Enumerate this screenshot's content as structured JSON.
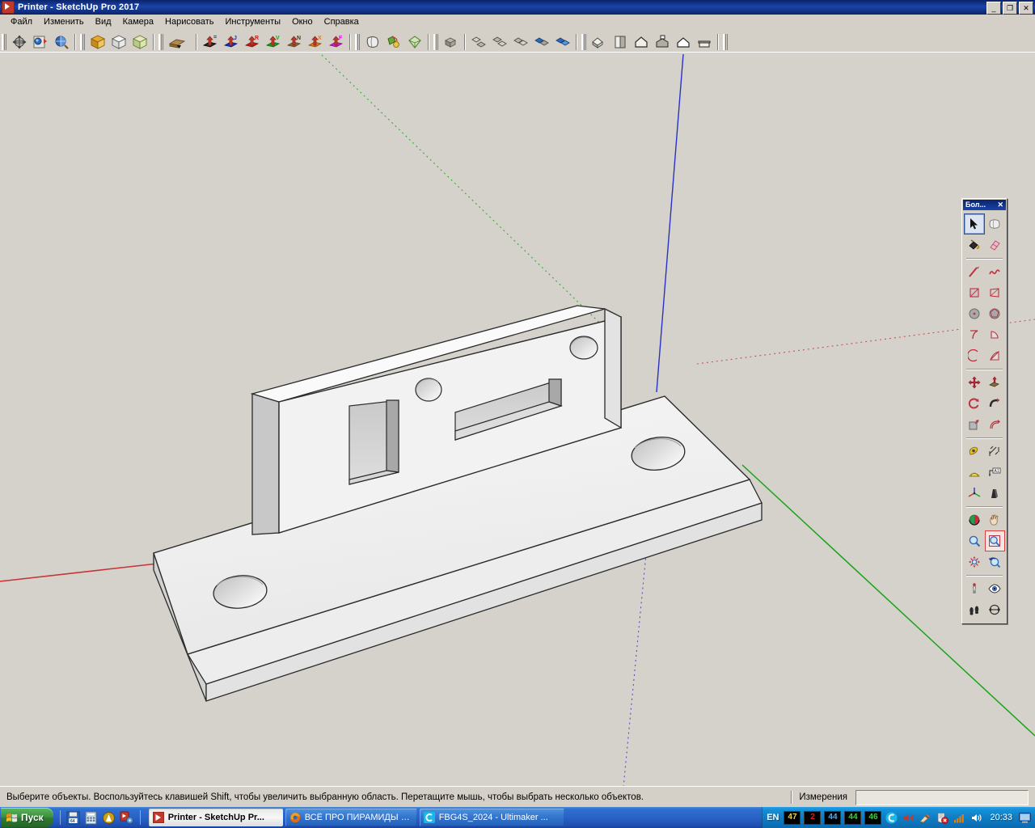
{
  "window": {
    "title": "Printer - SketchUp Pro 2017",
    "icon": "sketchup-icon",
    "controls": [
      {
        "name": "minimize-button",
        "glyph": "_"
      },
      {
        "name": "restore-button",
        "glyph": "❐"
      },
      {
        "name": "close-button",
        "glyph": "✕"
      }
    ]
  },
  "menubar": {
    "items": [
      {
        "label": "Файл",
        "name": "menu-file"
      },
      {
        "label": "Изменить",
        "name": "menu-edit"
      },
      {
        "label": "Вид",
        "name": "menu-view"
      },
      {
        "label": "Камера",
        "name": "menu-camera"
      },
      {
        "label": "Нарисовать",
        "name": "menu-draw"
      },
      {
        "label": "Инструменты",
        "name": "menu-tools"
      },
      {
        "label": "Окно",
        "name": "menu-window"
      },
      {
        "label": "Справка",
        "name": "menu-help"
      }
    ]
  },
  "toolbar": {
    "groups": [
      {
        "name": "standard-views-group",
        "buttons": [
          {
            "name": "orbit-icon",
            "title": "Орбита"
          },
          {
            "name": "position-camera-icon",
            "title": "Поместить камеру"
          },
          {
            "name": "walk-icon",
            "title": "Пройтись"
          }
        ]
      },
      {
        "name": "styles-group",
        "buttons": [
          {
            "name": "style-shaded-icon",
            "title": "С тенями"
          },
          {
            "name": "style-hidden-line-icon",
            "title": "Скрытая линия"
          },
          {
            "name": "style-texture-icon",
            "title": "С текстурой"
          }
        ]
      },
      {
        "name": "section-group",
        "buttons": [
          {
            "name": "section-plane-icon",
            "title": "Секущая плоскость"
          }
        ]
      },
      {
        "name": "axes-group",
        "buttons": [
          {
            "name": "layer-black-icon",
            "letter": "=",
            "color": "#1a1a1a"
          },
          {
            "name": "layer-blue-icon",
            "letter": "J",
            "color": "#1434b8"
          },
          {
            "name": "layer-red-icon",
            "letter": "R",
            "color": "#c0201c"
          },
          {
            "name": "layer-green-icon",
            "letter": "V",
            "color": "#1aa01a"
          },
          {
            "name": "layer-brown-icon",
            "letter": "N",
            "color": "#8a6a38"
          },
          {
            "name": "layer-orange-icon",
            "letter": "X",
            "color": "#e07818"
          },
          {
            "name": "layer-magenta-icon",
            "letter": "F",
            "color": "#d41ad4"
          }
        ]
      },
      {
        "name": "solid-tools-group",
        "buttons": [
          {
            "name": "solid-outer-shell-icon"
          },
          {
            "name": "solid-intersect-icon"
          },
          {
            "name": "solid-union-icon"
          }
        ]
      },
      {
        "name": "group-tools-group",
        "buttons": [
          {
            "name": "make-group-icon"
          }
        ]
      },
      {
        "name": "component-tools-group",
        "buttons": [
          {
            "name": "explode-icon"
          },
          {
            "name": "component-edit-icon"
          },
          {
            "name": "component-copy-icon"
          },
          {
            "name": "component-blue-icon"
          },
          {
            "name": "component-blue2-icon"
          }
        ]
      },
      {
        "name": "views-group",
        "buttons": [
          {
            "name": "view-iso-icon"
          },
          {
            "name": "view-top-icon"
          },
          {
            "name": "view-front-icon"
          },
          {
            "name": "view-right-icon"
          },
          {
            "name": "view-back-icon"
          },
          {
            "name": "view-left-icon"
          }
        ]
      }
    ]
  },
  "palette": {
    "title": "Бол...",
    "close_glyph": "✕",
    "tools": [
      [
        {
          "name": "select-tool",
          "label": "Выбрать",
          "selected": true
        },
        {
          "name": "make-component-tool",
          "label": "Создать компонент"
        }
      ],
      [
        {
          "name": "paint-bucket-tool",
          "label": "Заливка"
        },
        {
          "name": "eraser-tool",
          "label": "Ластик"
        }
      ],
      [
        {
          "name": "line-tool",
          "label": "Линия"
        },
        {
          "name": "freehand-tool",
          "label": "От руки"
        }
      ],
      [
        {
          "name": "rectangle-tool",
          "label": "Прямоугольник"
        },
        {
          "name": "rotated-rectangle-tool",
          "label": "Повёрнутый прямоугольник"
        }
      ],
      [
        {
          "name": "circle-tool",
          "label": "Окружность"
        },
        {
          "name": "polygon-tool",
          "label": "Многоугольник"
        }
      ],
      [
        {
          "name": "arc-tool",
          "label": "Дуга"
        },
        {
          "name": "pie-tool",
          "label": "Сектор"
        }
      ],
      [
        {
          "name": "two-point-arc-tool",
          "label": "Дуга по 2 точкам"
        },
        {
          "name": "three-point-arc-tool",
          "label": "Дуга по 3 точкам"
        }
      ],
      [
        {
          "name": "move-tool",
          "label": "Переместить"
        },
        {
          "name": "push-pull-tool",
          "label": "Вдавить/Вытянуть"
        }
      ],
      [
        {
          "name": "rotate-tool",
          "label": "Повернуть"
        },
        {
          "name": "follow-me-tool",
          "label": "Ведение"
        }
      ],
      [
        {
          "name": "scale-tool",
          "label": "Масштаб"
        },
        {
          "name": "offset-tool",
          "label": "Сместить"
        }
      ],
      [
        {
          "name": "tape-measure-tool",
          "label": "Рулетка"
        },
        {
          "name": "dimension-tool",
          "label": "Размер"
        }
      ],
      [
        {
          "name": "protractor-tool",
          "label": "Транспортир"
        },
        {
          "name": "text-tool",
          "label": "Текст"
        }
      ],
      [
        {
          "name": "axes-tool",
          "label": "Оси"
        },
        {
          "name": "three-d-text-tool",
          "label": "3D текст"
        }
      ],
      [
        {
          "name": "orbit-tool",
          "label": "Орбита"
        },
        {
          "name": "pan-tool",
          "label": "Панорама"
        }
      ],
      [
        {
          "name": "zoom-tool",
          "label": "Лупа"
        },
        {
          "name": "zoom-window-tool",
          "label": "Окно увеличения",
          "selected_red": true
        }
      ],
      [
        {
          "name": "zoom-extents-tool",
          "label": "Показать всё"
        },
        {
          "name": "previous-view-tool",
          "label": "Предыдущий вид"
        }
      ],
      [
        {
          "name": "position-camera-tool",
          "label": "Поместить камеру"
        },
        {
          "name": "look-around-tool",
          "label": "Осмотреться"
        }
      ],
      [
        {
          "name": "walk-tool",
          "label": "Пройтись"
        },
        {
          "name": "section-plane-tool",
          "label": "Секущая плоскость"
        }
      ]
    ]
  },
  "statusbar": {
    "message": "Выберите объекты. Воспользуйтесь клавишей Shift, чтобы увеличить выбранную область. Перетащите мышь, чтобы выбрать несколько объектов.",
    "measurements_label": "Измерения",
    "measurements_value": ""
  },
  "taskbar": {
    "start_label": "Пуск",
    "quick_launch": [
      {
        "name": "save-64-icon"
      },
      {
        "name": "calculator-icon"
      },
      {
        "name": "ammyy-icon"
      },
      {
        "name": "sketchup-quick-icon"
      }
    ],
    "tasks": [
      {
        "name": "taskbar-item-sketchup",
        "label": "Printer - SketchUp Pr...",
        "icon": "sketchup-icon",
        "active": true
      },
      {
        "name": "taskbar-item-firefox",
        "label": "ВСЁ ПРО ПИРАМИДЫ А...",
        "icon": "firefox-icon",
        "active": false
      },
      {
        "name": "taskbar-item-cura",
        "label": "FBG4S_2024 - Ultimaker ...",
        "icon": "cura-icon",
        "active": false
      }
    ],
    "tray": {
      "language": "EN",
      "gadgets": [
        {
          "name": "gadget-47",
          "value": "47",
          "color": "#e8d060"
        },
        {
          "name": "gadget-2",
          "value": "2",
          "color": "#d02020"
        },
        {
          "name": "gadget-44a",
          "value": "44",
          "color": "#5aa8e8"
        },
        {
          "name": "gadget-44b",
          "value": "44",
          "color": "#40d040"
        },
        {
          "name": "gadget-46",
          "value": "46",
          "color": "#40d040"
        }
      ],
      "icons": [
        {
          "name": "cura-tray-icon"
        },
        {
          "name": "volume-mute-icon"
        },
        {
          "name": "color-picker-icon"
        },
        {
          "name": "security-alert-icon"
        },
        {
          "name": "network-signal-icon"
        },
        {
          "name": "volume-icon"
        }
      ],
      "clock": "20:33",
      "show_desktop": "show-desktop-icon"
    }
  },
  "model": {
    "name": "printer-bracket-3d-model",
    "description": "L-shaped bracket: horizontal base plate with two round holes and a vertical face plate with two rectangular cutouts and two round holes",
    "background_color": "#d5d2cc",
    "face_color": "#f2f2f2",
    "axis_colors": {
      "red": "#c83232",
      "green": "#19a319",
      "blue": "#2832c8"
    }
  }
}
